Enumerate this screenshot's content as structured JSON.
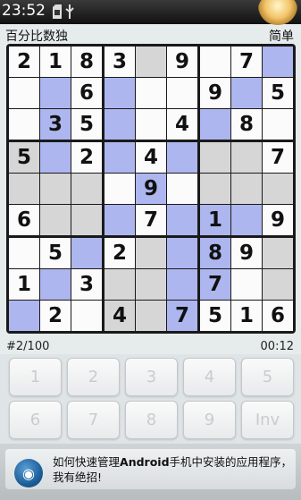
{
  "status_bar": {
    "time": "23:52",
    "icons": [
      "sd-card-icon",
      "usb-icon",
      "app-orb-icon"
    ]
  },
  "header": {
    "title": "百分比数独",
    "difficulty": "简单"
  },
  "board": {
    "digits": [
      [
        "2",
        "1",
        "8",
        "3",
        "",
        "9",
        "",
        "7",
        ""
      ],
      [
        "",
        "",
        "6",
        "",
        "",
        "",
        "9",
        "",
        "5"
      ],
      [
        "",
        "3",
        "5",
        "",
        "",
        "4",
        "",
        "8",
        ""
      ],
      [
        "5",
        "",
        "2",
        "",
        "4",
        "",
        "",
        "",
        "7"
      ],
      [
        "",
        "",
        "",
        "",
        "9",
        "",
        "",
        "",
        ""
      ],
      [
        "6",
        "",
        "",
        "",
        "7",
        "",
        "1",
        "",
        "9"
      ],
      [
        "",
        "5",
        "",
        "2",
        "",
        "",
        "8",
        "9",
        ""
      ],
      [
        "1",
        "",
        "3",
        "",
        "",
        "",
        "7",
        "",
        ""
      ],
      [
        "",
        "2",
        "",
        "4",
        "",
        "7",
        "5",
        "1",
        "6"
      ]
    ],
    "shades": [
      [
        "w",
        "w",
        "w",
        "w",
        "g",
        "w",
        "w",
        "w",
        "b"
      ],
      [
        "w",
        "b",
        "w",
        "b",
        "w",
        "w",
        "w",
        "b",
        "w"
      ],
      [
        "w",
        "b",
        "w",
        "b",
        "w",
        "w",
        "b",
        "w",
        "w"
      ],
      [
        "g",
        "b",
        "w",
        "b",
        "w",
        "b",
        "g",
        "g",
        "w"
      ],
      [
        "g",
        "g",
        "g",
        "w",
        "b",
        "w",
        "g",
        "g",
        "g"
      ],
      [
        "w",
        "g",
        "g",
        "b",
        "w",
        "b",
        "b",
        "b",
        "w"
      ],
      [
        "w",
        "w",
        "b",
        "w",
        "g",
        "b",
        "b",
        "w",
        "g"
      ],
      [
        "w",
        "b",
        "w",
        "g",
        "g",
        "b",
        "b",
        "w",
        "g"
      ],
      [
        "b",
        "w",
        "w",
        "g",
        "g",
        "b",
        "w",
        "w",
        "w"
      ]
    ],
    "colors": {
      "white": "#fbfbfb",
      "gray": "#d6d6d6",
      "blue": "#adb6ee"
    }
  },
  "footer": {
    "puzzle_number": "#2/100",
    "timer": "00:12"
  },
  "numpad": {
    "keys": [
      "1",
      "2",
      "3",
      "4",
      "5",
      "6",
      "7",
      "8",
      "9",
      "Inv"
    ]
  },
  "ad": {
    "text_prefix": "如何快速管理",
    "text_bold": "Android",
    "text_suffix": "手机中安装的应用程序，我有绝招!",
    "icon": "disc-icon"
  }
}
